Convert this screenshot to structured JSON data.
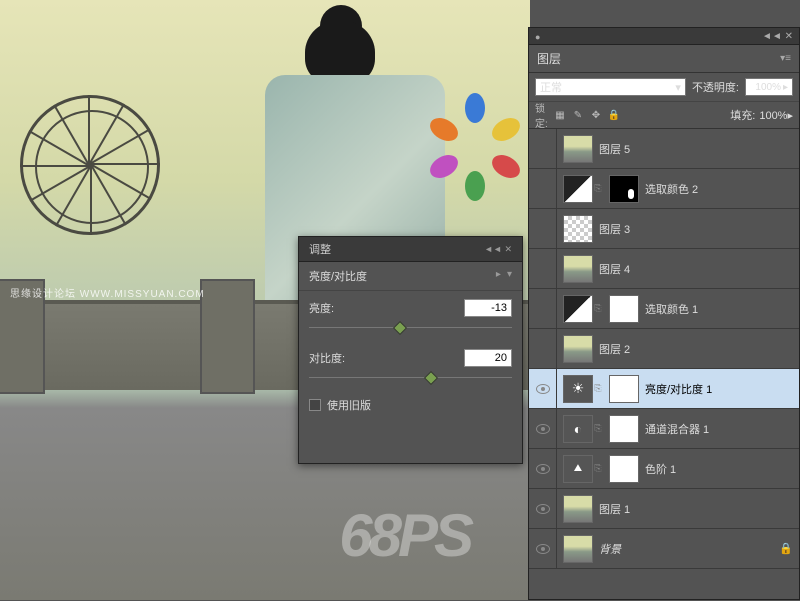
{
  "watermark": "思缘设计论坛  WWW.MISSYUAN.COM",
  "stamp": "68PS",
  "adjustments_panel": {
    "tab_label": "调整",
    "title": "亮度/对比度",
    "brightness_label": "亮度:",
    "brightness_value": "-13",
    "contrast_label": "对比度:",
    "contrast_value": "20",
    "use_legacy_label": "使用旧版"
  },
  "layers_panel": {
    "title": "图层",
    "blend_mode": "正常",
    "opacity_label": "不透明度:",
    "opacity_value": "100%",
    "lock_label": "锁定:",
    "fill_label": "填充:",
    "fill_value": "100%",
    "layers": [
      {
        "name": "图层 5",
        "visible": false,
        "type": "photo"
      },
      {
        "name": "选取颜色 2",
        "visible": false,
        "type": "adj-selcolor",
        "mask": "black"
      },
      {
        "name": "图层 3",
        "visible": false,
        "type": "trans"
      },
      {
        "name": "图层 4",
        "visible": false,
        "type": "photo"
      },
      {
        "name": "选取颜色 1",
        "visible": false,
        "type": "adj-selcolor",
        "mask": "white"
      },
      {
        "name": "图层 2",
        "visible": false,
        "type": "photo"
      },
      {
        "name": "亮度/对比度 1",
        "visible": true,
        "type": "adj-bright",
        "mask": "white",
        "selected": true
      },
      {
        "name": "通道混合器 1",
        "visible": true,
        "type": "adj-chmix",
        "mask": "white"
      },
      {
        "name": "色阶 1",
        "visible": true,
        "type": "adj-levels",
        "mask": "white"
      },
      {
        "name": "图层 1",
        "visible": true,
        "type": "photo"
      },
      {
        "name": "背景",
        "visible": true,
        "type": "photo",
        "locked": true,
        "italic": true
      }
    ]
  }
}
